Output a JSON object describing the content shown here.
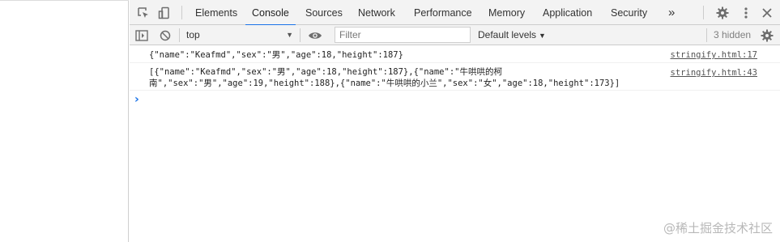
{
  "tabs": [
    {
      "label": "Elements"
    },
    {
      "label": "Console"
    },
    {
      "label": "Sources"
    },
    {
      "label": "Network"
    },
    {
      "label": "Performance"
    },
    {
      "label": "Memory"
    },
    {
      "label": "Application"
    },
    {
      "label": "Security"
    }
  ],
  "more_tabs_glyph": "»",
  "active_tab": "Console",
  "toolbar": {
    "context": "top",
    "filter_placeholder": "Filter",
    "levels": "Default levels",
    "hidden": "3 hidden"
  },
  "messages": [
    {
      "text": "{\"name\":\"Keafmd\",\"sex\":\"男\",\"age\":18,\"height\":187}",
      "source": "stringify.html:17"
    },
    {
      "text": "[{\"name\":\"Keafmd\",\"sex\":\"男\",\"age\":18,\"height\":187},{\"name\":\"牛哄哄的柯\n南\",\"sex\":\"男\",\"age\":19,\"height\":188},{\"name\":\"牛哄哄的小兰\",\"sex\":\"女\",\"age\":18,\"height\":173}]",
      "source": "stringify.html:43"
    }
  ],
  "prompt_glyph": "›",
  "watermark": "@稀土掘金技术社区",
  "colors": {
    "accent": "#1a73e8",
    "toolbar_bg": "#f3f3f3",
    "border": "#cccccc"
  },
  "icons": [
    "inspect-element-icon",
    "device-toolbar-icon",
    "gear-icon",
    "kebab-menu-icon",
    "close-icon",
    "sidebar-toggle-icon",
    "clear-console-icon",
    "eye-icon"
  ]
}
